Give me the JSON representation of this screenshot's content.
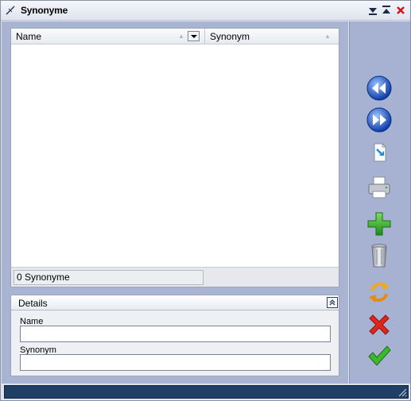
{
  "window": {
    "title": "Synonyme"
  },
  "grid": {
    "columns": [
      {
        "label": "Name"
      },
      {
        "label": "Synonym"
      }
    ],
    "footer_count": "0 Synonyme"
  },
  "details": {
    "title": "Details",
    "fields": [
      {
        "label": "Name",
        "value": ""
      },
      {
        "label": "Synonym",
        "value": ""
      }
    ]
  },
  "toolbar": {
    "icons": [
      "first-record-icon",
      "last-record-icon",
      "export-icon",
      "print-icon",
      "add-icon",
      "delete-icon",
      "refresh-icon",
      "cancel-icon",
      "confirm-icon"
    ]
  },
  "colors": {
    "toolbar_bg": "#a7b2d2",
    "statusbar_bg": "#1f3f66",
    "close_red": "#d0121c"
  }
}
